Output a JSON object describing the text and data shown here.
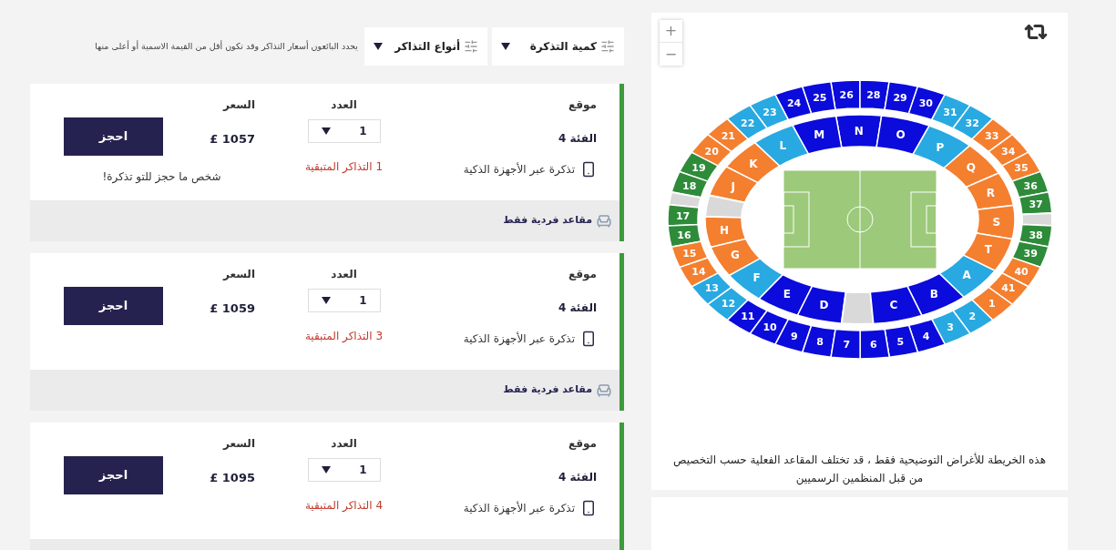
{
  "filters": {
    "note": "يحدد البائعون أسعار التذاكر وقد تكون أقل من القيمة الاسمية أو أعلى منها",
    "dropdowns": [
      {
        "label": "كمية التذكرة"
      },
      {
        "label": "أنواع التذاكر"
      }
    ]
  },
  "listings": [
    {
      "location_label": "موقع",
      "category": "الفئة 4",
      "delivery": "تذكرة عبر الأجهزة الذكية",
      "quantity_label": "العدد",
      "quantity": "1",
      "remaining": "1 التذاكر المتبقية",
      "price_label": "السعر",
      "price": "£ 1057",
      "button": "احجز",
      "note": "شخص ما حجز للتو تذكرة!",
      "feature": "مقاعد فردية فقط"
    },
    {
      "location_label": "موقع",
      "category": "الفئة 4",
      "delivery": "تذكرة عبر الأجهزة الذكية",
      "quantity_label": "العدد",
      "quantity": "1",
      "remaining": "3 التذاكر المتبقية",
      "price_label": "السعر",
      "price": "£ 1059",
      "button": "احجز",
      "feature": "مقاعد فردية فقط"
    },
    {
      "location_label": "موقع",
      "category": "الفئة 4",
      "delivery": "تذكرة عبر الأجهزة الذكية",
      "quantity_label": "العدد",
      "quantity": "1",
      "remaining": "4 التذاكر المتبقية",
      "price_label": "السعر",
      "price": "£ 1095",
      "button": "احجز"
    }
  ],
  "map": {
    "zoom_in": "+",
    "zoom_out": "−",
    "outer_ring": {
      "left": [
        {
          "kind": "section",
          "label": "26",
          "color": "#0b0bdc"
        },
        {
          "kind": "section",
          "label": "25",
          "color": "#0b0bdc"
        },
        {
          "kind": "section",
          "label": "24",
          "color": "#0b0bdc"
        },
        {
          "kind": "section",
          "label": "23",
          "color": "#28a9e1"
        },
        {
          "kind": "section",
          "label": "22",
          "color": "#28a9e1"
        },
        {
          "kind": "section",
          "label": "21",
          "color": "#f47f2f"
        },
        {
          "kind": "section",
          "label": "20",
          "color": "#f47f2f"
        },
        {
          "kind": "section",
          "label": "19",
          "color": "#2e8b3a"
        },
        {
          "kind": "section",
          "label": "18",
          "color": "#2e8b3a"
        },
        {
          "kind": "gap"
        },
        {
          "kind": "section",
          "label": "17",
          "color": "#2e8b3a"
        },
        {
          "kind": "section",
          "label": "16",
          "color": "#2e8b3a"
        },
        {
          "kind": "section",
          "label": "15",
          "color": "#f47f2f"
        },
        {
          "kind": "section",
          "label": "14",
          "color": "#f47f2f"
        },
        {
          "kind": "section",
          "label": "13",
          "color": "#28a9e1"
        },
        {
          "kind": "section",
          "label": "12",
          "color": "#28a9e1"
        },
        {
          "kind": "section",
          "label": "11",
          "color": "#0b0bdc"
        },
        {
          "kind": "section",
          "label": "10",
          "color": "#0b0bdc"
        },
        {
          "kind": "section",
          "label": "9",
          "color": "#0b0bdc"
        },
        {
          "kind": "section",
          "label": "8",
          "color": "#0b0bdc"
        }
      ],
      "right": [
        {
          "kind": "section",
          "label": "28",
          "color": "#0b0bdc"
        },
        {
          "kind": "section",
          "label": "29",
          "color": "#0b0bdc"
        },
        {
          "kind": "section",
          "label": "30",
          "color": "#0b0bdc"
        },
        {
          "kind": "section",
          "label": "31",
          "color": "#28a9e1"
        },
        {
          "kind": "section",
          "label": "32",
          "color": "#28a9e1"
        },
        {
          "kind": "section",
          "label": "33",
          "color": "#f47f2f"
        },
        {
          "kind": "section",
          "label": "34",
          "color": "#f47f2f"
        },
        {
          "kind": "section",
          "label": "35",
          "color": "#f47f2f"
        },
        {
          "kind": "section",
          "label": "36",
          "color": "#2e8b3a"
        },
        {
          "kind": "section",
          "label": "37",
          "color": "#2e8b3a"
        },
        {
          "kind": "gap"
        },
        {
          "kind": "section",
          "label": "38",
          "color": "#2e8b3a"
        },
        {
          "kind": "section",
          "label": "39",
          "color": "#2e8b3a"
        },
        {
          "kind": "section",
          "label": "40",
          "color": "#f47f2f"
        },
        {
          "kind": "section",
          "label": "41",
          "color": "#f47f2f"
        },
        {
          "kind": "section",
          "label": "1",
          "color": "#f47f2f"
        },
        {
          "kind": "section",
          "label": "2",
          "color": "#28a9e1"
        },
        {
          "kind": "section",
          "label": "3",
          "color": "#28a9e1"
        },
        {
          "kind": "section",
          "label": "4",
          "color": "#0b0bdc"
        },
        {
          "kind": "section",
          "label": "5",
          "color": "#0b0bdc"
        },
        {
          "kind": "section",
          "label": "6",
          "color": "#0b0bdc"
        },
        {
          "kind": "section",
          "label": "7",
          "color": "#0b0bdc"
        }
      ]
    },
    "inner_ring": {
      "left": [
        {
          "kind": "section",
          "label": "N",
          "color": "#0b0bdc"
        },
        {
          "kind": "section",
          "label": "M",
          "color": "#0b0bdc"
        },
        {
          "kind": "section",
          "label": "L",
          "color": "#28a9e1"
        },
        {
          "kind": "section",
          "label": "K",
          "color": "#f47f2f"
        },
        {
          "kind": "section",
          "label": "J",
          "color": "#f47f2f"
        },
        {
          "kind": "gap"
        },
        {
          "kind": "section",
          "label": "H",
          "color": "#f47f2f"
        },
        {
          "kind": "section",
          "label": "G",
          "color": "#f47f2f"
        },
        {
          "kind": "section",
          "label": "F",
          "color": "#28a9e1"
        },
        {
          "kind": "section",
          "label": "E",
          "color": "#0b0bdc"
        },
        {
          "kind": "section",
          "label": "D",
          "color": "#0b0bdc"
        },
        {
          "kind": "gap"
        }
      ],
      "right": [
        {
          "kind": "section",
          "label": "O",
          "color": "#0b0bdc"
        },
        {
          "kind": "section",
          "label": "P",
          "color": "#28a9e1"
        },
        {
          "kind": "section",
          "label": "Q",
          "color": "#f47f2f"
        },
        {
          "kind": "section",
          "label": "R",
          "color": "#f47f2f"
        },
        {
          "kind": "section",
          "label": "S",
          "color": "#f47f2f"
        },
        {
          "kind": "section",
          "label": "T",
          "color": "#f47f2f"
        },
        {
          "kind": "section",
          "label": "A",
          "color": "#28a9e1"
        },
        {
          "kind": "section",
          "label": "B",
          "color": "#0b0bdc"
        },
        {
          "kind": "section",
          "label": "C",
          "color": "#0b0bdc"
        }
      ]
    },
    "disclaimer": "هذه الخريطة للأغراض التوضيحية فقط ، قد تختلف المقاعد الفعلية حسب التخصيص من قبل المنظمين الرسميين"
  }
}
